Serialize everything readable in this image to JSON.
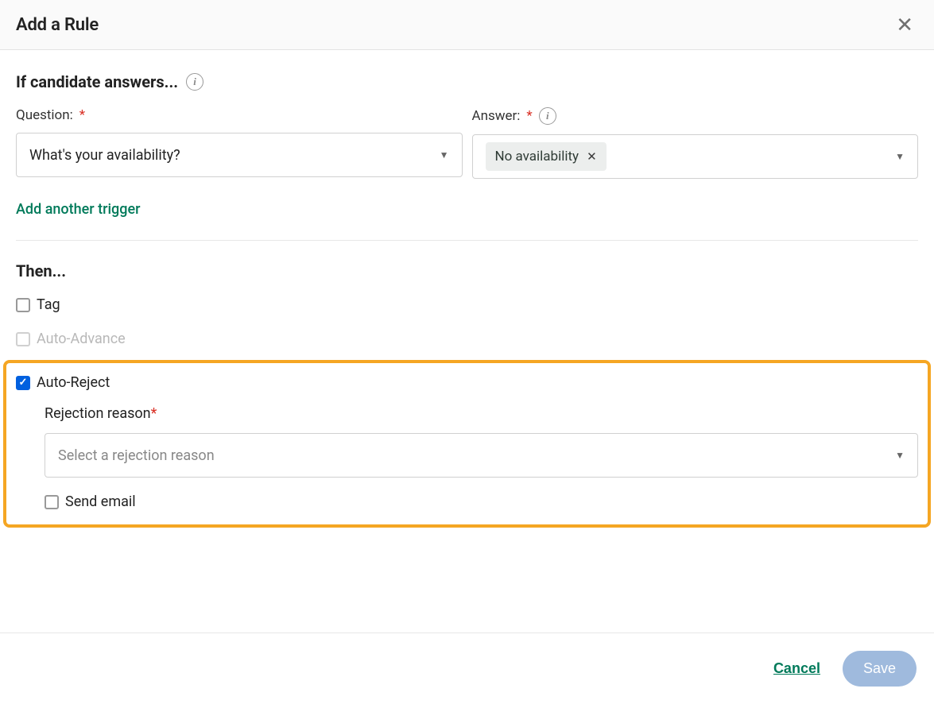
{
  "modal": {
    "title": "Add a Rule"
  },
  "if_section": {
    "heading": "If candidate answers...",
    "question": {
      "label": "Question:",
      "value": "What's your availability?"
    },
    "answer": {
      "label": "Answer:",
      "chip": "No availability"
    },
    "add_trigger": "Add another trigger"
  },
  "then_section": {
    "heading": "Then...",
    "options": {
      "tag": {
        "label": "Tag",
        "checked": false,
        "enabled": true
      },
      "auto_advance": {
        "label": "Auto-Advance",
        "checked": false,
        "enabled": false
      },
      "auto_reject": {
        "label": "Auto-Reject",
        "checked": true,
        "enabled": true
      }
    },
    "rejection": {
      "label": "Rejection reason",
      "placeholder": "Select a rejection reason"
    },
    "send_email": {
      "label": "Send email",
      "checked": false
    }
  },
  "footer": {
    "cancel": "Cancel",
    "save": "Save"
  }
}
